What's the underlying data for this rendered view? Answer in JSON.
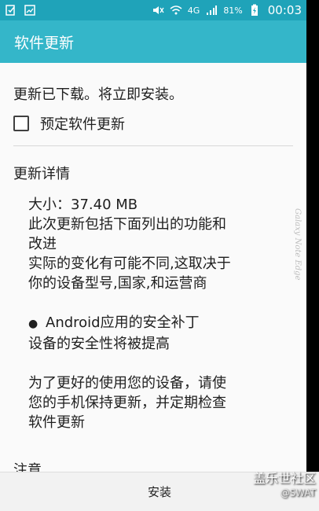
{
  "status_bar": {
    "network": "4G",
    "battery": "81%",
    "time": "00:03",
    "icons": [
      "notification-check-icon",
      "image-icon",
      "mute-icon",
      "wifi-icon",
      "signal-icon",
      "battery-charging-icon"
    ]
  },
  "app_bar": {
    "title": "软件更新"
  },
  "content": {
    "message": "更新已下载。将立即安装。",
    "schedule_label": "预定软件更新",
    "section_title": "更新详情",
    "details": {
      "size_line": "大小：37.40 MB",
      "desc_1": "此次更新包括下面列出的功能和",
      "desc_2": "改进",
      "desc_3": "实际的变化有可能不同,这取决于",
      "desc_4": "你的设备型号,国家,和运营商",
      "bullet_title": "Android应用的安全补丁",
      "bullet_desc": "设备的安全性将被提高",
      "tip_1": "为了更好的使用您的设备，请使",
      "tip_2": "您的手机保持更新，并定期检查",
      "tip_3": "软件更新"
    },
    "note": "注意"
  },
  "edge_label": "Galaxy Note Edge",
  "bottom": {
    "install_label": "安装"
  },
  "watermark": {
    "main": "盖乐世社区",
    "sub": "@SWAT"
  },
  "colors": {
    "status_bar": "#1fa3b9",
    "app_bar": "#34b6c9",
    "background": "#fafafa"
  }
}
